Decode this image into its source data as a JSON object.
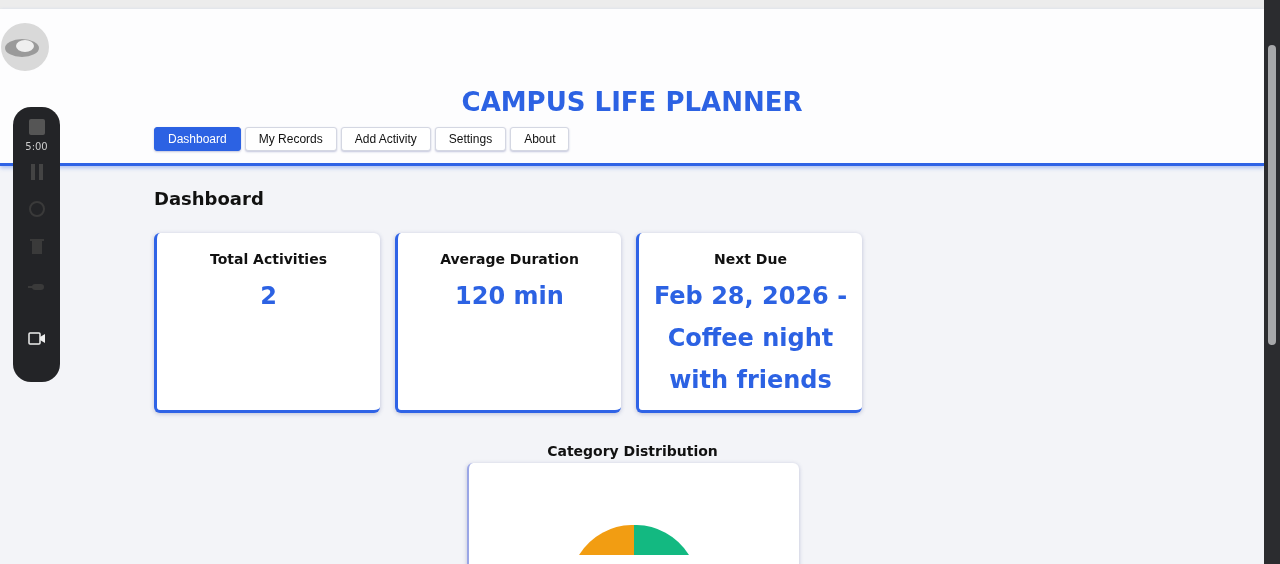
{
  "recorder": {
    "timer": "5:00"
  },
  "app": {
    "title": "CAMPUS LIFE PLANNER"
  },
  "tabs": [
    {
      "label": "Dashboard",
      "selected": true
    },
    {
      "label": "My Records",
      "selected": false
    },
    {
      "label": "Add Activity",
      "selected": false
    },
    {
      "label": "Settings",
      "selected": false
    },
    {
      "label": "About",
      "selected": false
    }
  ],
  "page": {
    "heading": "Dashboard"
  },
  "stats": [
    {
      "label": "Total Activities",
      "value": "2"
    },
    {
      "label": "Average Duration",
      "value": "120 min"
    },
    {
      "label": "Next Due",
      "value": "Feb 28, 2026 - Coffee night with friends"
    }
  ],
  "chart": {
    "title": "Category Distribution"
  }
}
